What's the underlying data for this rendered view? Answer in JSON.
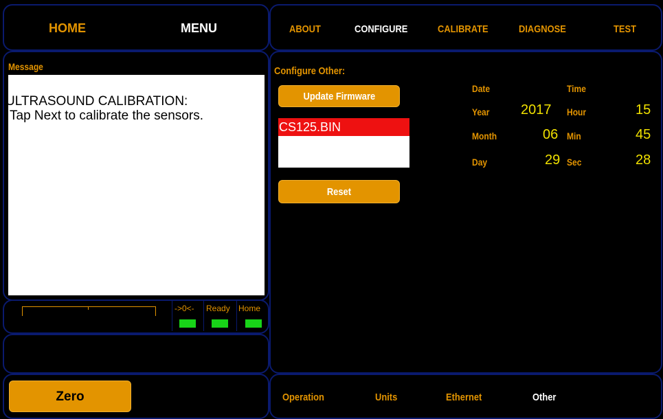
{
  "top_nav": {
    "home": "HOME",
    "menu": "MENU",
    "about": "ABOUT",
    "configure": "CONFIGURE",
    "calibrate": "CALIBRATE",
    "diagnose": "DIAGNOSE",
    "test": "TEST"
  },
  "message_panel": {
    "title": "Message",
    "line1": "ULTRASOUND CALIBRATION:",
    "line2": "Tap Next to calibrate the sensors."
  },
  "status_bar": {
    "zero_label": "->0<-",
    "ready_label": "Ready",
    "home_label": "Home",
    "led_color": "#18d418"
  },
  "configure_other": {
    "title": "Configure Other:",
    "update_firmware": "Update Firmware",
    "files": [
      "CS125.BIN"
    ],
    "selected_file": "CS125.BIN",
    "reset": "Reset"
  },
  "datetime": {
    "date_header": "Date",
    "time_header": "Time",
    "year_label": "Year",
    "year_value": "2017",
    "month_label": "Month",
    "month_value": "06",
    "day_label": "Day",
    "day_value": "29",
    "hour_label": "Hour",
    "hour_value": "15",
    "min_label": "Min",
    "min_value": "45",
    "sec_label": "Sec",
    "sec_value": "28"
  },
  "bottom": {
    "zero_button": "Zero",
    "tabs": [
      "Operation",
      "Units",
      "Ethernet",
      "Other"
    ],
    "active_tab": "Other"
  },
  "colors": {
    "accent": "#e39400",
    "value": "#f0e000",
    "selection": "#ee1111",
    "panel_border": "#0a1a6e"
  }
}
